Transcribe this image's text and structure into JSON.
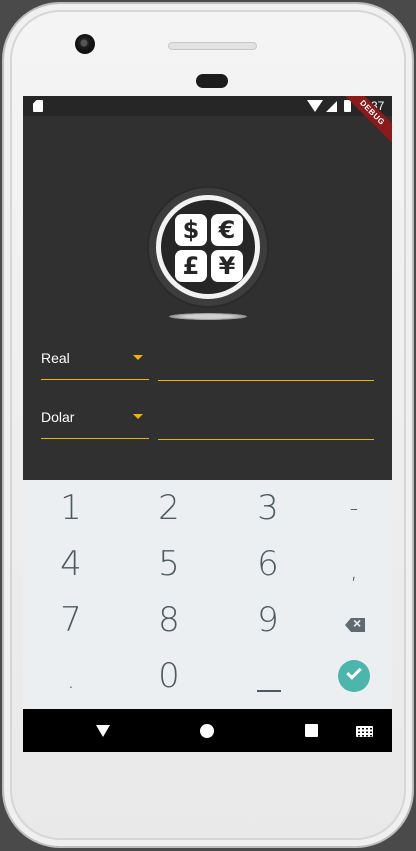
{
  "status_bar": {
    "time": "2:37",
    "debug_banner": "DEBUG"
  },
  "logo": {
    "symbols": [
      "$",
      "€",
      "£",
      "¥"
    ]
  },
  "converter": {
    "from": {
      "currency": "Real",
      "amount": ""
    },
    "to": {
      "currency": "Dolar",
      "amount": ""
    }
  },
  "keyboard": {
    "keys": [
      "1",
      "2",
      "3",
      "-",
      "4",
      "5",
      "6",
      ",",
      "7",
      "8",
      "9",
      ".",
      "0"
    ]
  },
  "colors": {
    "accent": "#f0b400",
    "background": "#303030",
    "keyboard": "#eceff1",
    "done": "#4db6ac"
  }
}
